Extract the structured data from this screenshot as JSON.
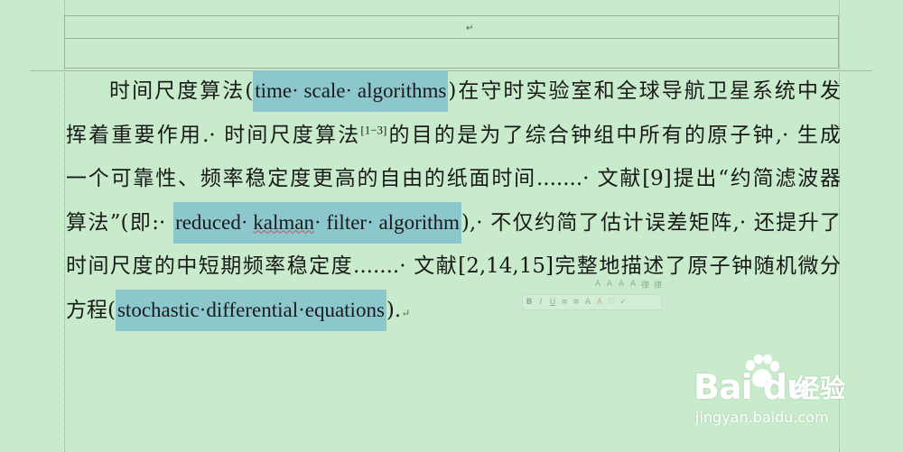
{
  "document": {
    "header_mark": "↵",
    "lines": [
      {
        "t1": "时间尺度算法(",
        "hl": "time· scale· algorithms",
        "t2": ")在守时实验室和全球导航卫星系统中发"
      },
      {
        "t1": "挥着重要作用.· 时间尺度算法",
        "sup": "[1−3]",
        "t2": "的目的是为了综合钟组中所有的原子钟,· 生成"
      },
      {
        "t1": "一个可靠性、频率稳定度更高的自由的纸面时间.......· 文献[9]提出“约简滤波器"
      },
      {
        "t1": "算法”(即:· ",
        "hl_a": "reduced· ",
        "hl_b": "kalman",
        "hl_c": "· filter· algorithm",
        "t2": "),· 不仅约简了估计误差矩阵,· 还提升了"
      },
      {
        "t1": "时间尺度的中短期频率稳定度.......· 文献[2,14,15]完整地描述了原子钟随机微分"
      },
      {
        "t1": "方程(",
        "hl": "stochastic·differential·equations",
        "t2": ").",
        "pmark": "↵"
      }
    ]
  },
  "mini_toolbar": {
    "row1": [
      "A",
      "A",
      "A",
      "A",
      "律",
      "律"
    ],
    "row2": [
      "B",
      "I",
      "U",
      "≡",
      "≡",
      "A",
      "A",
      "♡",
      "✓"
    ]
  },
  "watermark": {
    "logo": "Bai du",
    "logo_cn": "经验",
    "url": "jingyan.baidu.com"
  },
  "colors": {
    "page_bg": "#c8ebcb",
    "selection": "#8cc7ce"
  }
}
